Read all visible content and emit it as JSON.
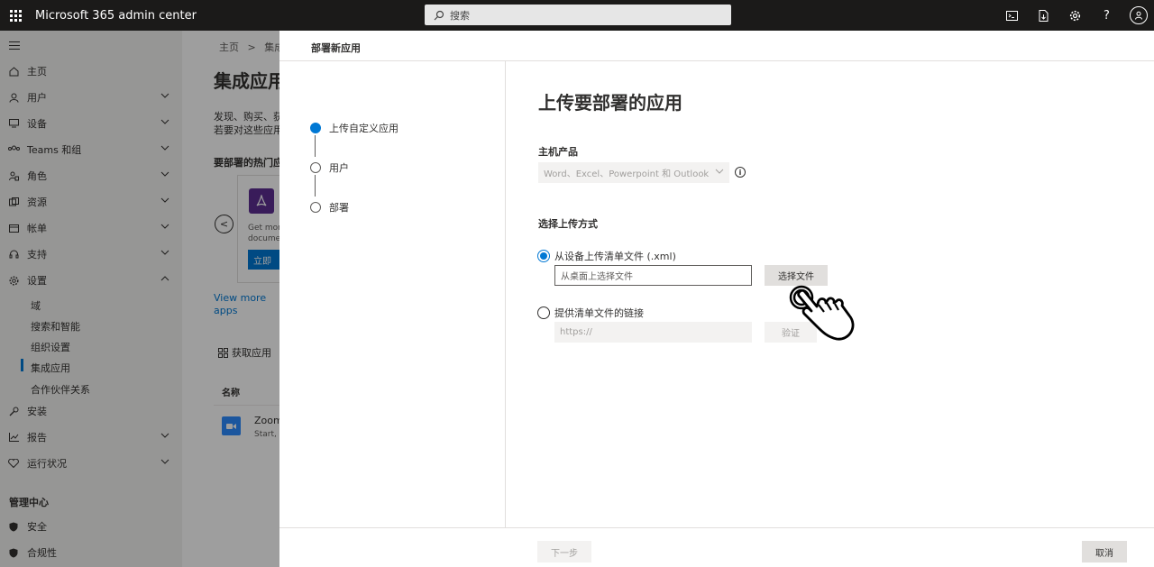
{
  "topbar": {
    "app_title": "Microsoft 365 admin center",
    "search_placeholder": "搜索",
    "icons": [
      "terminal-icon",
      "download-doc-icon",
      "gear-icon",
      "help-icon",
      "avatar"
    ]
  },
  "nav": {
    "items": [
      {
        "label": "主页",
        "icon": "home-icon"
      },
      {
        "label": "用户",
        "icon": "user-icon"
      },
      {
        "label": "设备",
        "icon": "device-icon"
      },
      {
        "label": "Teams 和组",
        "icon": "teams-icon"
      },
      {
        "label": "角色",
        "icon": "roles-icon"
      },
      {
        "label": "资源",
        "icon": "resources-icon"
      },
      {
        "label": "帐单",
        "icon": "billing-icon"
      },
      {
        "label": "支持",
        "icon": "support-icon"
      },
      {
        "label": "设置",
        "icon": "settings-icon"
      }
    ],
    "settings_sub": [
      "域",
      "搜索和智能",
      "组织设置",
      "集成应用",
      "合作伙伴关系"
    ],
    "items2": [
      {
        "label": "安装",
        "icon": "wrench-icon"
      },
      {
        "label": "报告",
        "icon": "report-icon"
      },
      {
        "label": "运行状况",
        "icon": "health-icon"
      }
    ],
    "admin_center_heading": "管理中心",
    "admin_items": [
      {
        "label": "安全",
        "icon": "shield-icon"
      },
      {
        "label": "合规性",
        "icon": "compliance-icon"
      }
    ]
  },
  "main": {
    "crumb_home": "主页",
    "crumb_current": "集成应",
    "title": "集成应用",
    "desc_line1": "发现、购买、获",
    "desc_line2": "若要对这些应用",
    "popular": "要部署的热门应",
    "card_getmore_1": "Get more",
    "card_getmore_2": "documen",
    "card_button": "立即",
    "view_more": "View more apps",
    "get_apps": "获取应用",
    "col_name": "名称",
    "zoom_name": "Zoom",
    "zoom_sub": "Start, s"
  },
  "panel": {
    "title": "部署新应用",
    "steps": [
      {
        "label": "上传自定义应用",
        "active": true
      },
      {
        "label": "用户",
        "active": false
      },
      {
        "label": "部署",
        "active": false
      }
    ],
    "content_title": "上传要部署的应用",
    "host_label": "主机产品",
    "host_value": "Word、Excel、Powerpoint 和 Outlook",
    "upload_method_label": "选择上传方式",
    "option_file": "从设备上传清单文件 (.xml)",
    "file_placeholder": "从桌面上选择文件",
    "choose_file": "选择文件",
    "option_link": "提供清单文件的链接",
    "link_placeholder": "https://",
    "verify": "验证",
    "next": "下一步",
    "cancel": "取消"
  }
}
